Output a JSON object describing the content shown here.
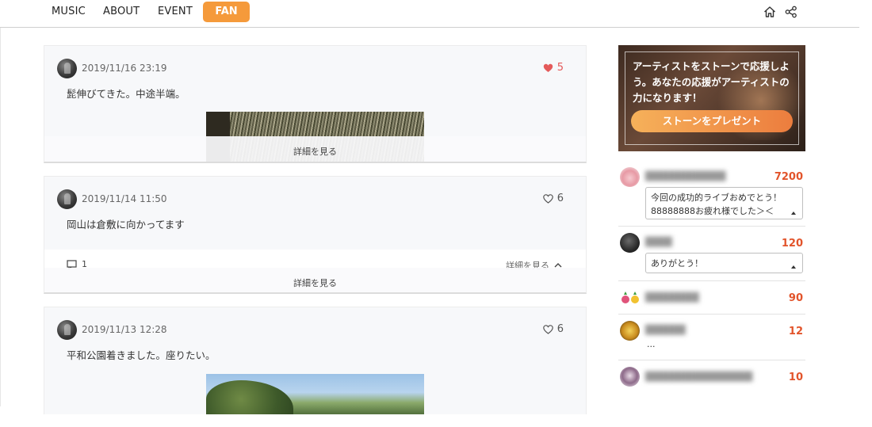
{
  "nav": {
    "items": [
      "MUSIC",
      "ABOUT",
      "EVENT"
    ],
    "active": "FAN",
    "icons": [
      "home-icon",
      "share-icon"
    ]
  },
  "colors": {
    "accent": "#f59a3b",
    "like_red": "#e45a5a",
    "stone_count": "#e2542b"
  },
  "posts": [
    {
      "date": "2019/11/16 23:19",
      "text": "髭伸びてきた。中途半端。",
      "likes": "5",
      "liked": true,
      "detail_label": "詳細を見る"
    },
    {
      "date": "2019/11/14 11:50",
      "text": "岡山は倉敷に向かってます",
      "likes": "6",
      "liked": false,
      "comment_count": "1",
      "comment_detail_label": "詳細を見る",
      "detail_label": "詳細を見る"
    },
    {
      "date": "2019/11/13 12:28",
      "text": "平和公園着きました。座りたい。",
      "likes": "6",
      "liked": false
    }
  ],
  "banner": {
    "text": "アーティストをストーンで応援しよう。あなたの応援がアーティストの力になります！",
    "button_label": "ストーンをプレゼント"
  },
  "supporters": [
    {
      "stones": "7200",
      "message": "今回の成功的ライブおめでとう！88888888お疲れ様でした＞＜"
    },
    {
      "stones": "120",
      "message": "ありがとう！"
    },
    {
      "stones": "90"
    },
    {
      "stones": "12",
      "message": "..."
    },
    {
      "stones": "10"
    }
  ]
}
